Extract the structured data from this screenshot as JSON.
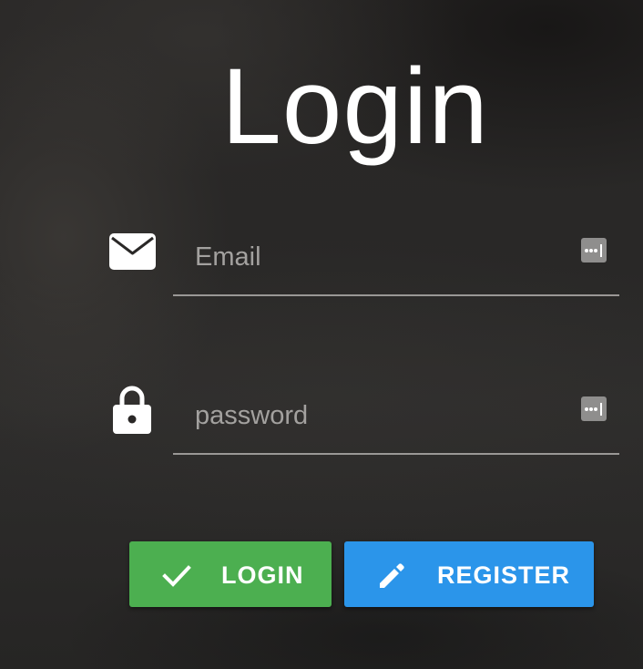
{
  "title": "Login",
  "email_field": {
    "placeholder": "Email",
    "value": "",
    "icon": "envelope-icon",
    "autofill_icon": "password-manager-key-icon"
  },
  "password_field": {
    "placeholder": "password",
    "value": "",
    "icon": "lock-icon",
    "autofill_icon": "password-manager-key-icon"
  },
  "buttons": {
    "login": {
      "label": "LOGIN",
      "icon": "check-icon",
      "color": "#4caf50"
    },
    "register": {
      "label": "REGISTER",
      "icon": "pencil-icon",
      "color": "#2b95ea"
    }
  }
}
